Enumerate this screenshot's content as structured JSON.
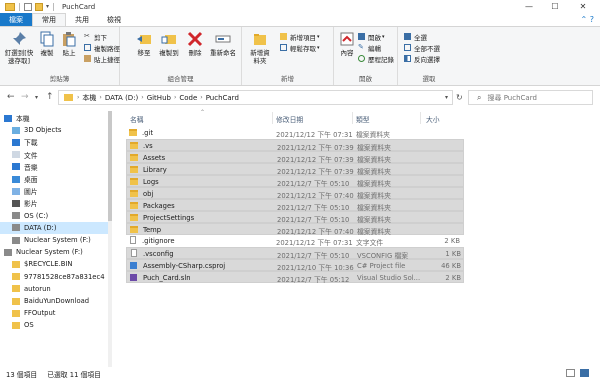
{
  "window": {
    "title": "PuchCard"
  },
  "tabs": {
    "file": "檔案",
    "home": "常用",
    "share": "共用",
    "view": "檢視"
  },
  "ribbon": {
    "clipboard": {
      "label": "剪貼簿",
      "pin": "釘選到[快速存取]",
      "copy": "複製",
      "paste": "貼上",
      "cut": "剪下",
      "copy_path": "複製路徑",
      "paste_shortcut": "貼上捷徑"
    },
    "organize": {
      "label": "組合管理",
      "move_to": "移至",
      "copy_to": "複製到",
      "delete": "刪除",
      "rename": "重新命名"
    },
    "new": {
      "label": "新增",
      "new_folder": "新增資料夾",
      "new_item": "新增項目",
      "easy_access": "輕鬆存取"
    },
    "open": {
      "label": "開啟",
      "properties": "內容",
      "open": "開啟",
      "edit": "編輯",
      "history": "歷程記錄"
    },
    "select": {
      "label": "選取",
      "select_all": "全選",
      "select_none": "全部不選",
      "invert": "反向選擇"
    }
  },
  "address": {
    "crumbs": [
      "本機",
      "DATA (D:)",
      "GitHub",
      "Code",
      "PuchCard"
    ],
    "search_placeholder": "搜尋 PuchCard"
  },
  "nav": [
    {
      "label": "本機",
      "icon": "computer-icon"
    },
    {
      "label": "3D Objects",
      "icon": "3d-objects-icon"
    },
    {
      "label": "下載",
      "icon": "download-icon"
    },
    {
      "label": "文件",
      "icon": "document-icon"
    },
    {
      "label": "音樂",
      "icon": "music-icon"
    },
    {
      "label": "桌面",
      "icon": "desktop-icon"
    },
    {
      "label": "圖片",
      "icon": "pictures-icon"
    },
    {
      "label": "影片",
      "icon": "videos-icon"
    },
    {
      "label": "OS (C:)",
      "icon": "drive-icon"
    },
    {
      "label": "DATA (D:)",
      "icon": "drive-icon"
    },
    {
      "label": "Nuclear System (F:)",
      "icon": "drive-icon"
    },
    {
      "label": "Nuclear System (F:)",
      "icon": "drive-icon"
    },
    {
      "label": "$RECYCLE.BIN",
      "icon": "folder-icon"
    },
    {
      "label": "97781528ce87a831ec4",
      "icon": "folder-icon"
    },
    {
      "label": "autorun",
      "icon": "folder-icon"
    },
    {
      "label": "BaiduYunDownload",
      "icon": "folder-icon"
    },
    {
      "label": "FFOutput",
      "icon": "folder-icon"
    },
    {
      "label": "OS",
      "icon": "folder-icon"
    }
  ],
  "columns": {
    "name": "名稱",
    "date": "修改日期",
    "type": "類型",
    "size": "大小"
  },
  "files": [
    {
      "name": ".git",
      "date": "2021/12/12 下午 07:31",
      "type": "檔案資料夾",
      "size": "",
      "icon": "folder"
    },
    {
      "name": ".vs",
      "date": "2021/12/12 下午 07:39",
      "type": "檔案資料夾",
      "size": "",
      "icon": "folder"
    },
    {
      "name": "Assets",
      "date": "2021/12/12 下午 07:39",
      "type": "檔案資料夾",
      "size": "",
      "icon": "folder"
    },
    {
      "name": "Library",
      "date": "2021/12/12 下午 07:39",
      "type": "檔案資料夾",
      "size": "",
      "icon": "folder"
    },
    {
      "name": "Logs",
      "date": "2021/12/7 下午 05:10",
      "type": "檔案資料夾",
      "size": "",
      "icon": "folder"
    },
    {
      "name": "obj",
      "date": "2021/12/12 下午 07:40",
      "type": "檔案資料夾",
      "size": "",
      "icon": "folder"
    },
    {
      "name": "Packages",
      "date": "2021/12/7 下午 05:10",
      "type": "檔案資料夾",
      "size": "",
      "icon": "folder"
    },
    {
      "name": "ProjectSettings",
      "date": "2021/12/7 下午 05:10",
      "type": "檔案資料夾",
      "size": "",
      "icon": "folder"
    },
    {
      "name": "Temp",
      "date": "2021/12/12 下午 07:40",
      "type": "檔案資料夾",
      "size": "",
      "icon": "folder"
    },
    {
      "name": ".gitignore",
      "date": "2021/12/12 下午 07:31",
      "type": "文字文件",
      "size": "2 KB",
      "icon": "file"
    },
    {
      "name": ".vsconfig",
      "date": "2021/12/7 下午 05:10",
      "type": "VSCONFIG 檔案",
      "size": "1 KB",
      "icon": "file"
    },
    {
      "name": "Assembly-CSharp.csproj",
      "date": "2021/12/10 下午 10:36",
      "type": "C# Project file",
      "size": "46 KB",
      "icon": "cs"
    },
    {
      "name": "Puch_Card.sln",
      "date": "2021/12/7 下午 05:12",
      "type": "Visual Studio Sol...",
      "size": "2 KB",
      "icon": "vs"
    }
  ],
  "selected_rows": [
    1,
    2,
    3,
    4,
    5,
    6,
    7,
    8,
    10,
    11,
    12
  ],
  "status": {
    "count": "13 個項目",
    "selected": "已選取 11 個項目"
  }
}
